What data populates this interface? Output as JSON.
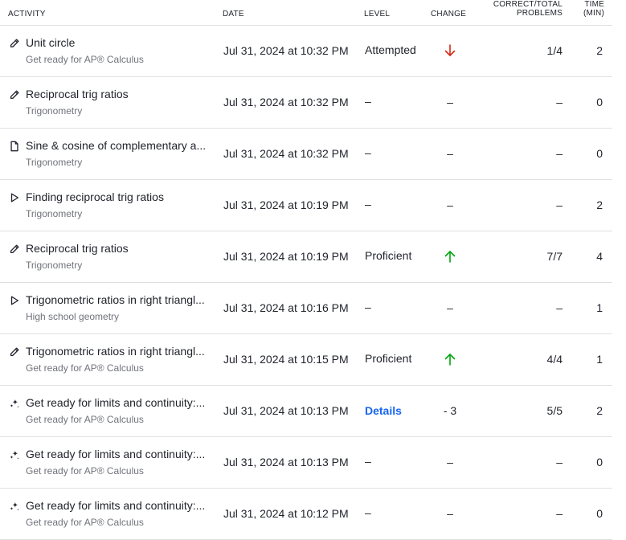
{
  "headers": {
    "activity": "ACTIVITY",
    "date": "DATE",
    "level": "LEVEL",
    "change": "CHANGE",
    "ratio_line1": "CORRECT/TOTAL",
    "ratio_line2": "PROBLEMS",
    "time_line1": "TIME",
    "time_line2": "(MIN)"
  },
  "colors": {
    "down_arrow": "#d92916",
    "up_arrow": "#00a60e",
    "link": "#1865f2"
  },
  "rows": [
    {
      "icon": "pencil-icon",
      "title": "Unit circle",
      "subtitle": "Get ready for AP® Calculus",
      "date": "Jul 31, 2024 at 10:32 PM",
      "level": "Attempted",
      "change": "down-arrow-icon",
      "ratio": "1/4",
      "time": "2"
    },
    {
      "icon": "pencil-icon",
      "title": "Reciprocal trig ratios",
      "subtitle": "Trigonometry",
      "date": "Jul 31, 2024 at 10:32 PM",
      "level": "–",
      "change": "–",
      "ratio": "–",
      "time": "0"
    },
    {
      "icon": "document-icon",
      "title": "Sine & cosine of complementary a...",
      "subtitle": "Trigonometry",
      "date": "Jul 31, 2024 at 10:32 PM",
      "level": "–",
      "change": "–",
      "ratio": "–",
      "time": "0"
    },
    {
      "icon": "play-icon",
      "title": "Finding reciprocal trig ratios",
      "subtitle": "Trigonometry",
      "date": "Jul 31, 2024 at 10:19 PM",
      "level": "–",
      "change": "–",
      "ratio": "–",
      "time": "2"
    },
    {
      "icon": "pencil-icon",
      "title": "Reciprocal trig ratios",
      "subtitle": "Trigonometry",
      "date": "Jul 31, 2024 at 10:19 PM",
      "level": "Proficient",
      "change": "up-arrow-icon",
      "ratio": "7/7",
      "time": "4"
    },
    {
      "icon": "play-icon",
      "title": "Trigonometric ratios in right triangl...",
      "subtitle": "High school geometry",
      "date": "Jul 31, 2024 at 10:16 PM",
      "level": "–",
      "change": "–",
      "ratio": "–",
      "time": "1"
    },
    {
      "icon": "pencil-icon",
      "title": "Trigonometric ratios in right triangl...",
      "subtitle": "Get ready for AP® Calculus",
      "date": "Jul 31, 2024 at 10:15 PM",
      "level": "Proficient",
      "change": "up-arrow-icon",
      "ratio": "4/4",
      "time": "1"
    },
    {
      "icon": "sparkle-icon",
      "title": "Get ready for limits and continuity:...",
      "subtitle": "Get ready for AP® Calculus",
      "date": "Jul 31, 2024 at 10:13 PM",
      "level": "Details",
      "level_is_link": true,
      "change": "- 3",
      "ratio": "5/5",
      "time": "2"
    },
    {
      "icon": "sparkle-icon",
      "title": "Get ready for limits and continuity:...",
      "subtitle": "Get ready for AP® Calculus",
      "date": "Jul 31, 2024 at 10:13 PM",
      "level": "–",
      "change": "–",
      "ratio": "–",
      "time": "0"
    },
    {
      "icon": "sparkle-icon",
      "title": "Get ready for limits and continuity:...",
      "subtitle": "Get ready for AP® Calculus",
      "date": "Jul 31, 2024 at 10:12 PM",
      "level": "–",
      "change": "–",
      "ratio": "–",
      "time": "0"
    }
  ]
}
